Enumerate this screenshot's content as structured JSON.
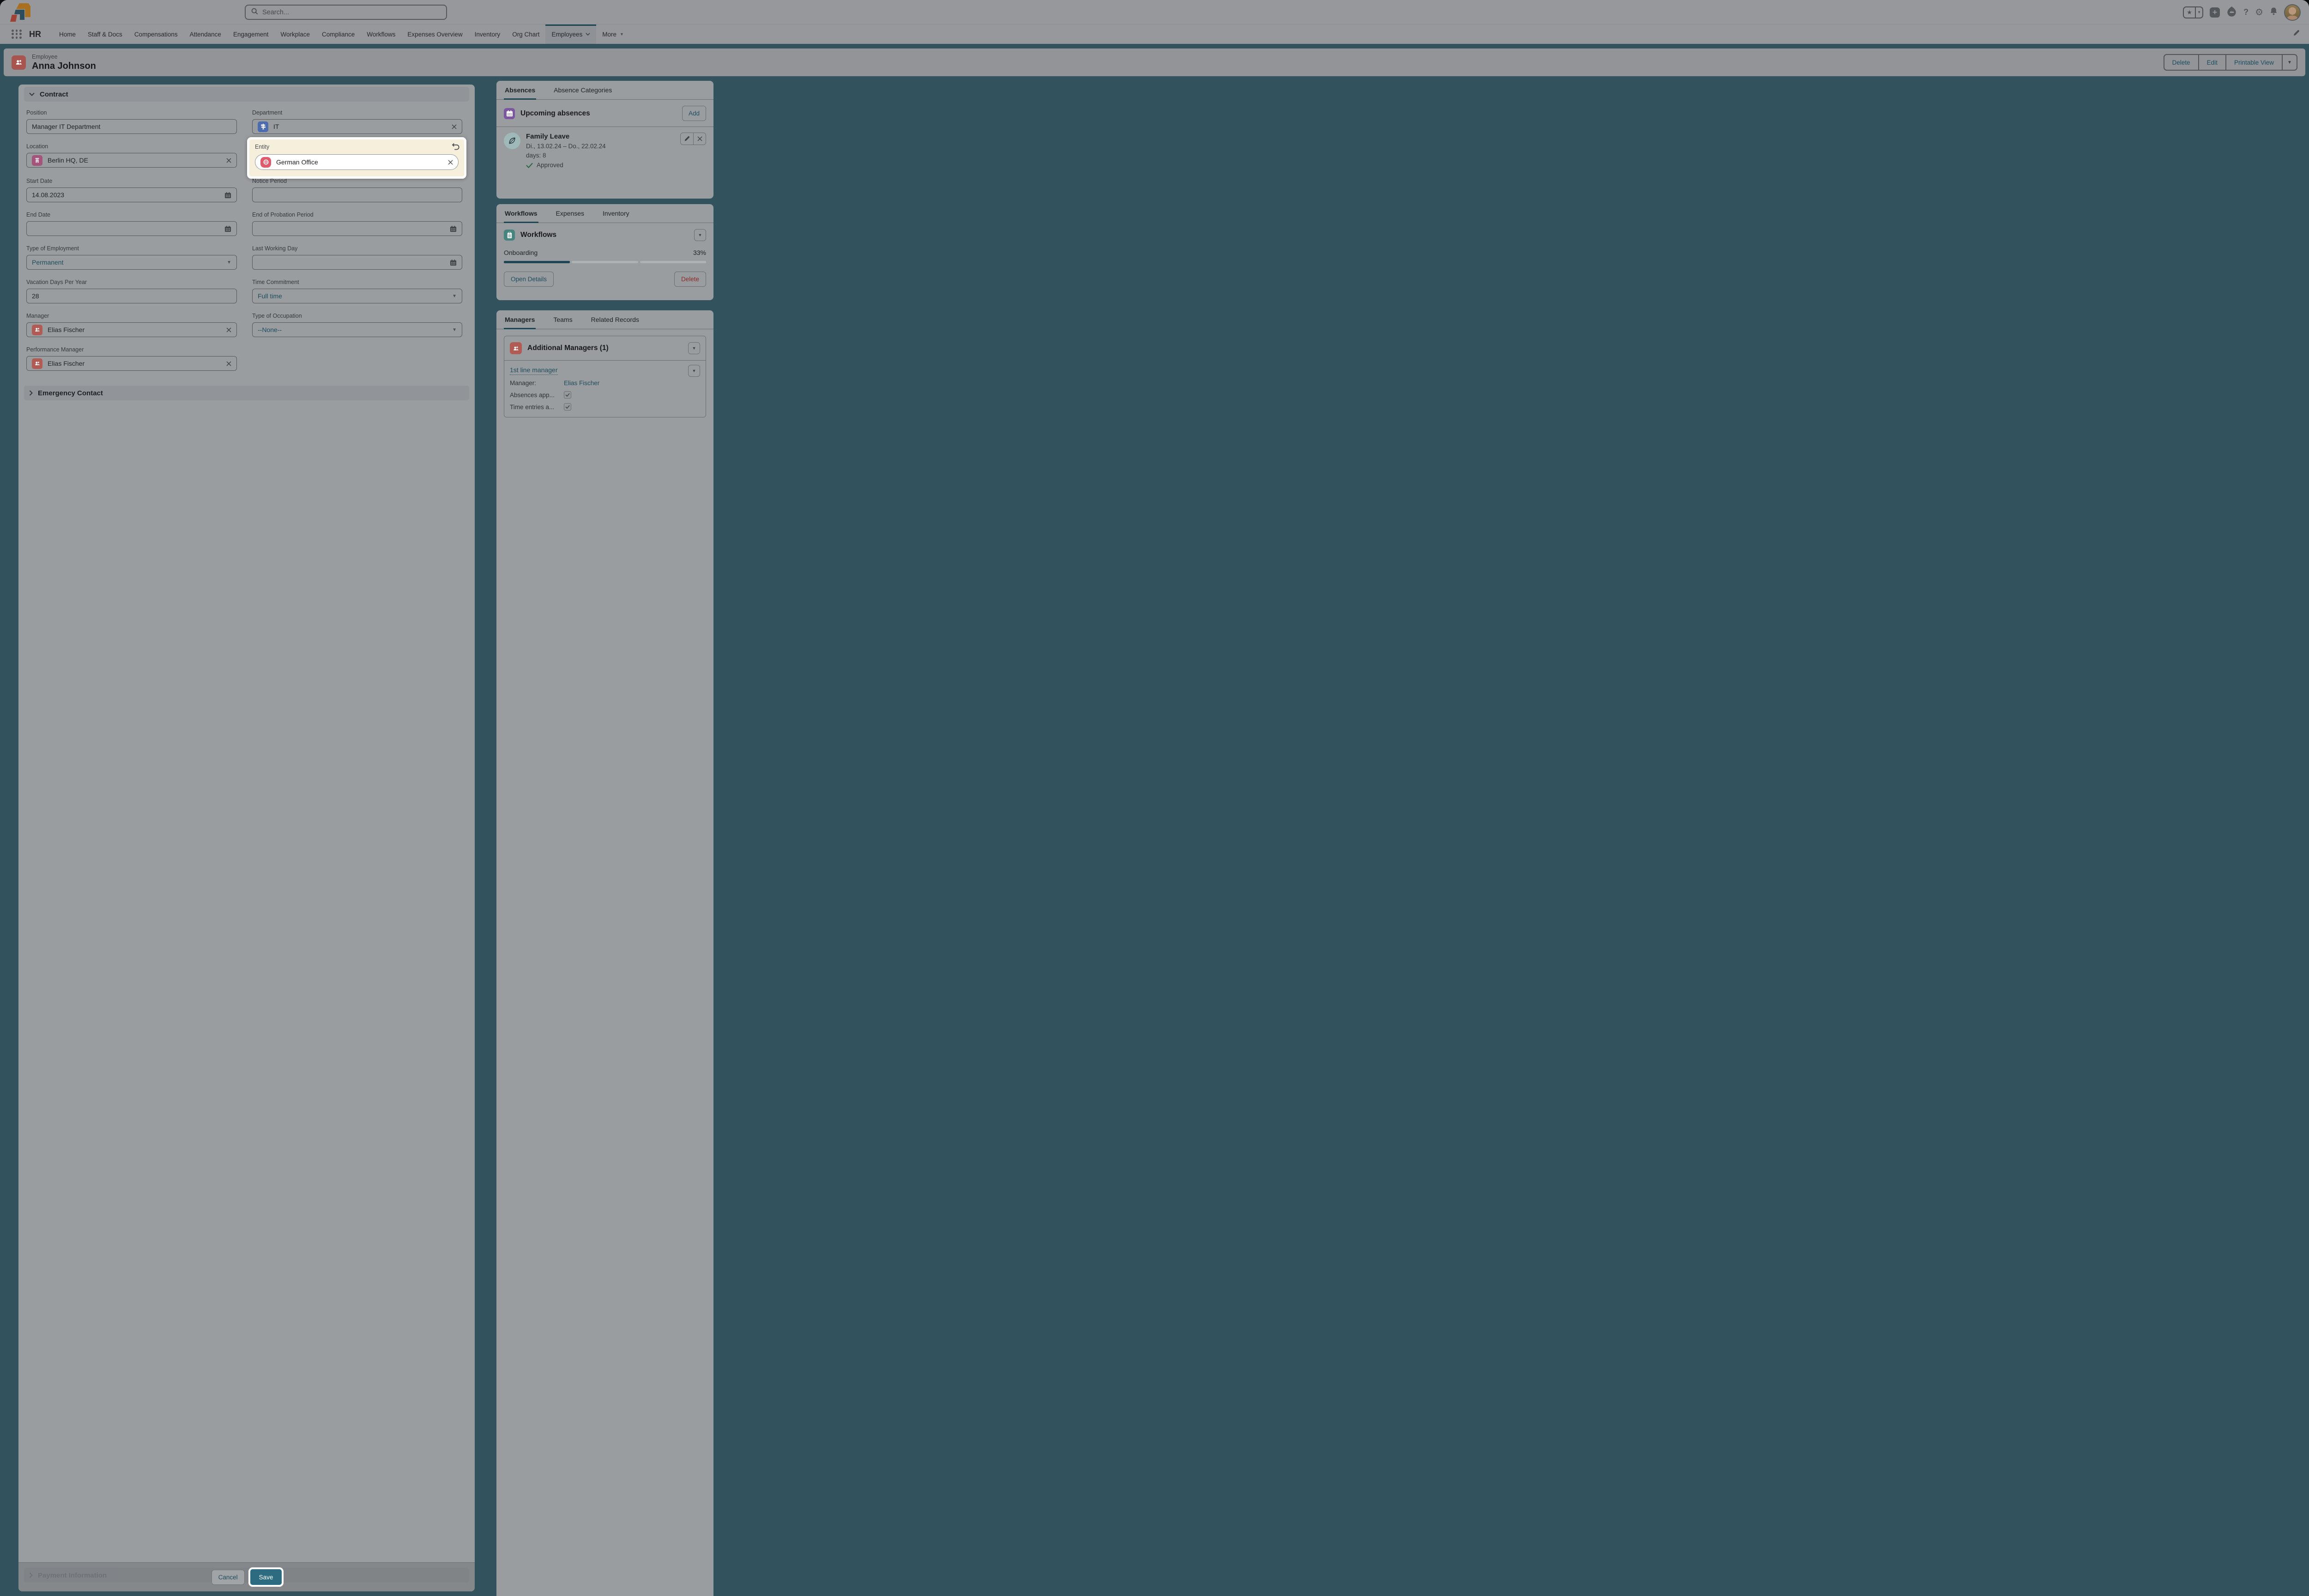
{
  "window": {
    "search_placeholder": "Search..."
  },
  "nav": {
    "app_name": "HR",
    "tabs": [
      "Home",
      "Staff & Docs",
      "Compensations",
      "Attendance",
      "Engagement",
      "Workplace",
      "Compliance",
      "Workflows",
      "Expenses Overview",
      "Inventory",
      "Org Chart",
      "Employees",
      "More"
    ],
    "active_tab": "Employees"
  },
  "record_header": {
    "type": "Employee",
    "name": "Anna Johnson",
    "actions": [
      "Delete",
      "Edit",
      "Printable View"
    ]
  },
  "form": {
    "section_contract": "Contract",
    "section_emergency": "Emergency Contact",
    "section_payment": "Payment Information",
    "cancel_label": "Cancel",
    "save_label": "Save",
    "fields": {
      "position": {
        "label": "Position",
        "value": "Manager IT Department"
      },
      "department": {
        "label": "Department",
        "value": "IT"
      },
      "location": {
        "label": "Location",
        "value": "Berlin HQ, DE"
      },
      "entity": {
        "label": "Entity",
        "value": "German Office"
      },
      "start_date": {
        "label": "Start Date",
        "value": "14.08.2023"
      },
      "notice_period": {
        "label": "Notice Period",
        "value": ""
      },
      "end_date": {
        "label": "End Date",
        "value": ""
      },
      "end_probation": {
        "label": "End of Probation Period",
        "value": ""
      },
      "type_employment": {
        "label": "Type of Employment",
        "value": "Permanent"
      },
      "last_working_day": {
        "label": "Last Working Day",
        "value": ""
      },
      "vacation_days": {
        "label": "Vacation Days Per Year",
        "value": "28"
      },
      "time_commitment": {
        "label": "Time Commitment",
        "value": "Full time"
      },
      "manager": {
        "label": "Manager",
        "value": "Elias Fischer"
      },
      "type_occupation": {
        "label": "Type of Occupation",
        "value": "--None--"
      },
      "performance_manager": {
        "label": "Performance Manager",
        "value": "Elias Fischer"
      }
    }
  },
  "absences_panel": {
    "tabs": [
      "Absences",
      "Absence Categories"
    ],
    "title": "Upcoming absences",
    "add_label": "Add",
    "item": {
      "title": "Family Leave",
      "date_range": "Di., 13.02.24 – Do., 22.02.24",
      "days": "days: 8",
      "status": "Approved"
    }
  },
  "workflows_panel": {
    "tabs": [
      "Workflows",
      "Expenses",
      "Inventory"
    ],
    "title": "Workflows",
    "workflow_name": "Onboarding",
    "progress_label": "33%",
    "progress_percent": 33,
    "open_details_label": "Open Details",
    "delete_label": "Delete"
  },
  "managers_panel": {
    "tabs": [
      "Managers",
      "Teams",
      "Related Records"
    ],
    "title": "Additional Managers (1)",
    "link": "1st line manager",
    "rows": [
      {
        "label": "Manager:",
        "value": "Elias Fischer"
      },
      {
        "label": "Absences app...",
        "checked": true
      },
      {
        "label": "Time entries a...",
        "checked": true
      }
    ]
  },
  "colors": {
    "accent_teal_bright": "#2d6b80",
    "accent_teal_dim": "#1e4553",
    "highlight_cream": "#f6efdb",
    "highlight_ring": "#ffffff",
    "approved_green": "#2a6343",
    "delete_red": "#8e2a27",
    "entity_icon_pink": "#e05a6d",
    "department_icon_blue": "#4d6cb0",
    "location_icon_rose": "#a4537b",
    "absence_icon_purple": "#7d56a2",
    "workflow_icon_teal": "#47837f",
    "people_icon_red": "#b05c55",
    "logo_orange": "#a9701f",
    "logo_teal": "#2b4d5c",
    "logo_red": "#a14136"
  }
}
